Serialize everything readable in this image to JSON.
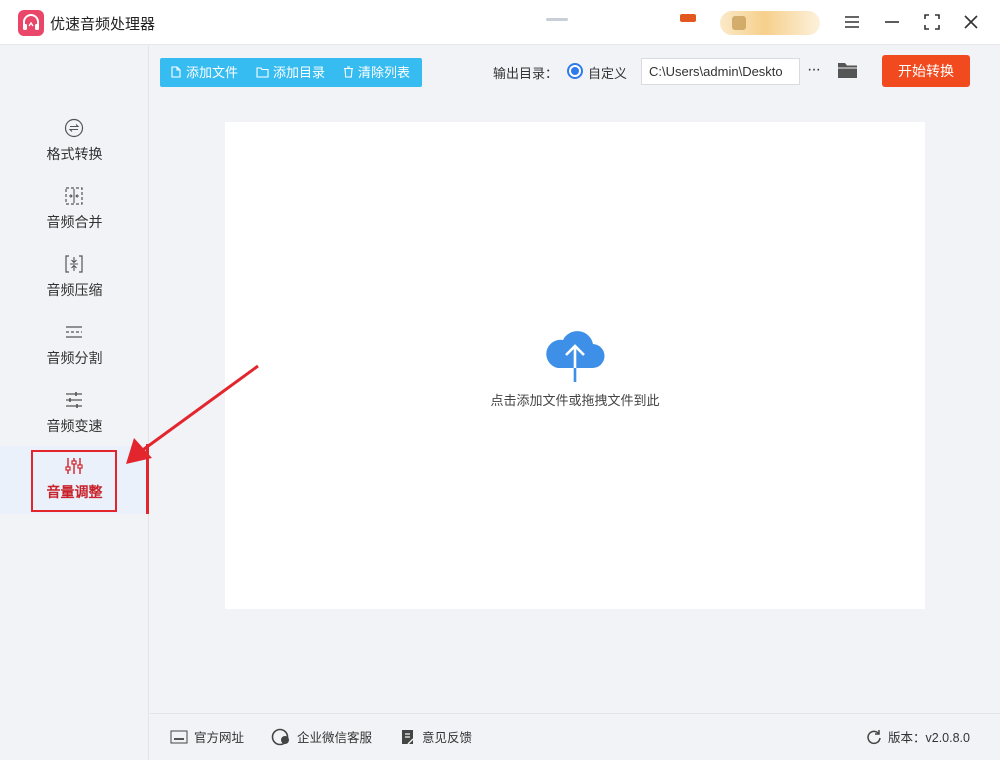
{
  "app": {
    "title": "优速音频处理器"
  },
  "window_controls": {
    "icons": [
      "menu-icon",
      "minimize-icon",
      "maximize-icon",
      "close-icon"
    ]
  },
  "sidebar": {
    "items": [
      {
        "label": "格式转换",
        "icon": "format-convert-icon",
        "active": false
      },
      {
        "label": "音频合并",
        "icon": "merge-icon",
        "active": false
      },
      {
        "label": "音频压缩",
        "icon": "compress-icon",
        "active": false
      },
      {
        "label": "音频分割",
        "icon": "split-icon",
        "active": false
      },
      {
        "label": "音频变速",
        "icon": "speed-icon",
        "active": false
      },
      {
        "label": "音量调整",
        "icon": "volume-sliders-icon",
        "active": true
      }
    ]
  },
  "toolbar": {
    "add_file": "添加文件",
    "add_dir": "添加目录",
    "clear_list": "清除列表",
    "output_label": "输出目录：",
    "radio_label": "自定义",
    "output_path": "C:\\Users\\admin\\Deskto",
    "more": "···",
    "start": "开始转换"
  },
  "dropzone": {
    "hint": "点击添加文件或拖拽文件到此"
  },
  "footer": {
    "site": "官方网址",
    "wechat": "企业微信客服",
    "feedback": "意见反馈",
    "version": "版本：v2.0.8.0"
  },
  "colors": {
    "accent_blue": "#36bcf0",
    "start_orange": "#f04a1e",
    "active_red": "#c8232c",
    "cloud_blue": "#3d8fe8"
  }
}
